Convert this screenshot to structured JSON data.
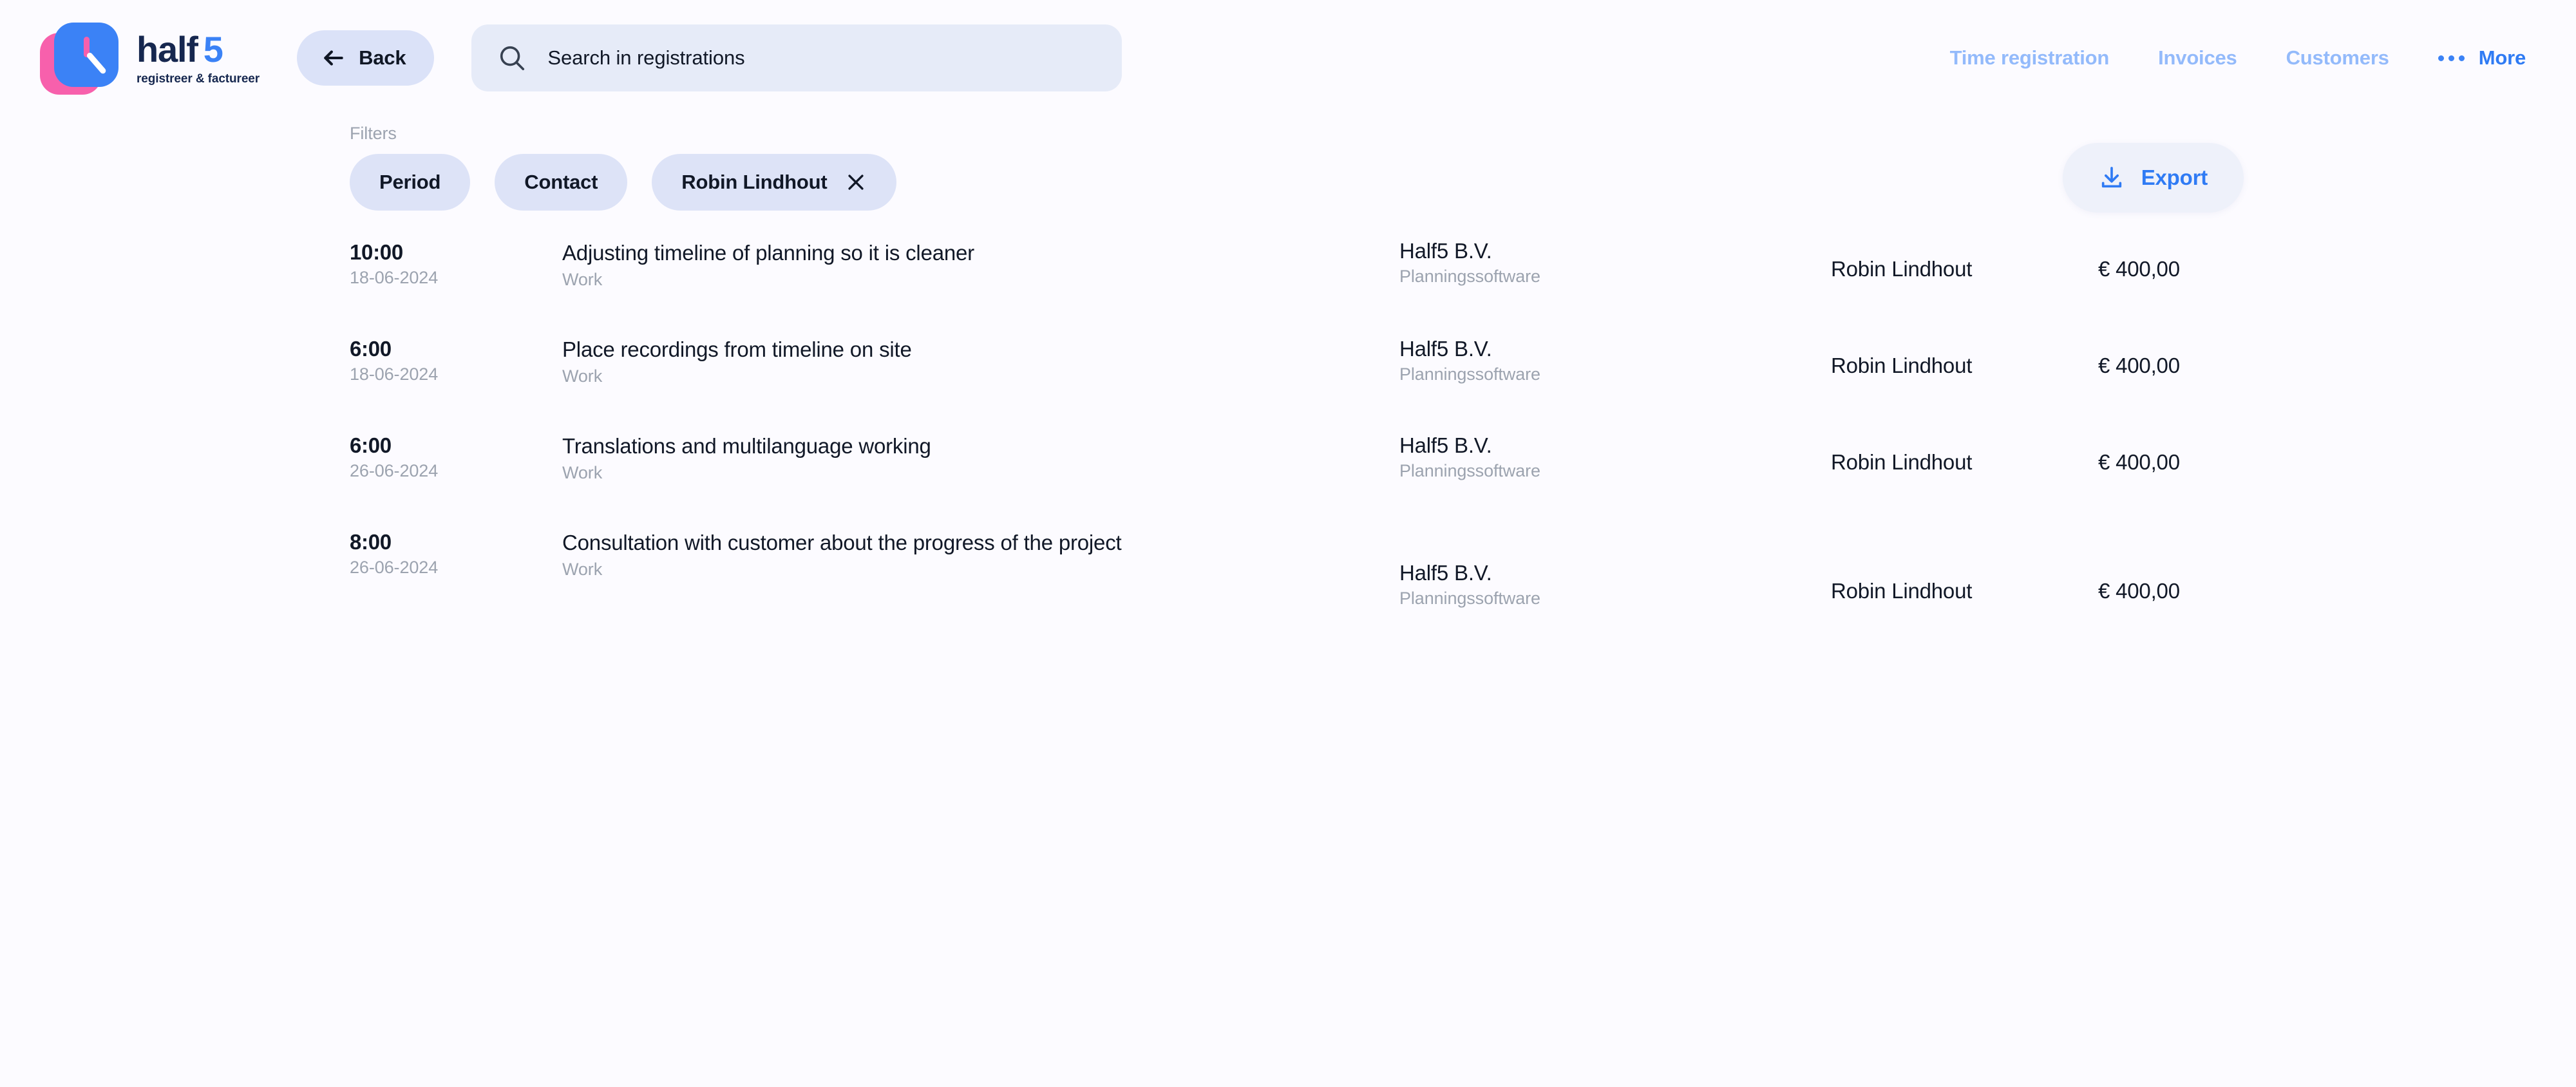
{
  "brand": {
    "name_primary": "half",
    "name_accent": "5",
    "tagline": "registreer & factureer",
    "logo_icon": "clock-icon",
    "colors": {
      "navy": "#16274F",
      "blue": "#3B82F6",
      "pink": "#F760AC"
    }
  },
  "header": {
    "back_button": {
      "label": "Back",
      "icon": "arrow-left-icon"
    },
    "search": {
      "placeholder": "Search in registrations",
      "value": "",
      "icon": "search-icon"
    },
    "nav_links": [
      {
        "label": "Time registration"
      },
      {
        "label": "Invoices"
      },
      {
        "label": "Customers"
      }
    ],
    "more": {
      "label": "More",
      "icon": "ellipsis-icon"
    },
    "colors": {
      "nav_inactive": "#93BAFB",
      "nav_active": "#2F7BF4"
    }
  },
  "filters": {
    "label": "Filters",
    "chips": [
      {
        "label": "Period",
        "removable": false
      },
      {
        "label": "Contact",
        "removable": false
      },
      {
        "label": "Robin Lindhout",
        "removable": true,
        "remove_icon": "close-icon"
      }
    ],
    "export_button": {
      "label": "Export",
      "icon": "download-icon"
    }
  },
  "registrations": [
    {
      "time": "10:00",
      "date": "18-06-2024",
      "title": "Adjusting timeline of planning so it is cleaner",
      "category": "Work",
      "client": "Half5 B.V.",
      "project": "Planningssoftware",
      "user": "Robin Lindhout",
      "amount": "€ 400,00"
    },
    {
      "time": "6:00",
      "date": "18-06-2024",
      "title": "Place recordings from timeline on site",
      "category": "Work",
      "client": "Half5 B.V.",
      "project": "Planningssoftware",
      "user": "Robin Lindhout",
      "amount": "€ 400,00"
    },
    {
      "time": "6:00",
      "date": "26-06-2024",
      "title": "Translations and multilanguage working",
      "category": "Work",
      "client": "Half5 B.V.",
      "project": "Planningssoftware",
      "user": "Robin Lindhout",
      "amount": "€ 400,00"
    },
    {
      "time": "8:00",
      "date": "26-06-2024",
      "title": "Consultation with customer about the progress of the project",
      "category": "Work",
      "client": "Half5 B.V.",
      "project": "Planningssoftware",
      "user": "Robin Lindhout",
      "amount": "€ 400,00"
    }
  ]
}
